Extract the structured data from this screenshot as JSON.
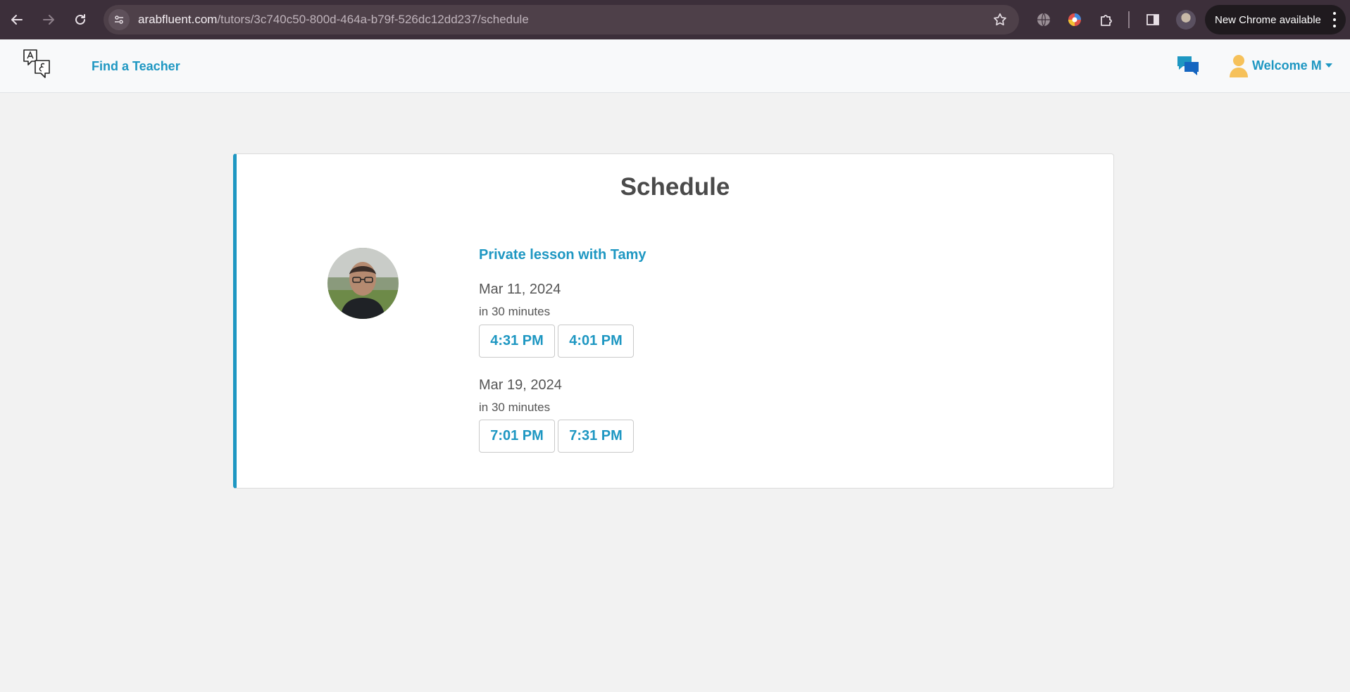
{
  "browser": {
    "url_host": "arabfluent.com",
    "url_path": "/tutors/3c740c50-800d-464a-b79f-526dc12dd237/schedule",
    "update_label": "New Chrome available"
  },
  "header": {
    "find_teacher_label": "Find a Teacher",
    "welcome_label": "Welcome M"
  },
  "schedule": {
    "title": "Schedule",
    "lesson_title": "Private lesson with Tamy",
    "days": [
      {
        "date": "Mar 11, 2024",
        "duration": "in 30 minutes",
        "times": [
          "4:31 PM",
          "4:01 PM"
        ]
      },
      {
        "date": "Mar 19, 2024",
        "duration": "in 30 minutes",
        "times": [
          "7:01 PM",
          "7:31 PM"
        ]
      }
    ]
  },
  "colors": {
    "brand": "#1e97c2",
    "chrome_bg": "#3c2f3a",
    "page_bg": "#f2f2f2"
  }
}
